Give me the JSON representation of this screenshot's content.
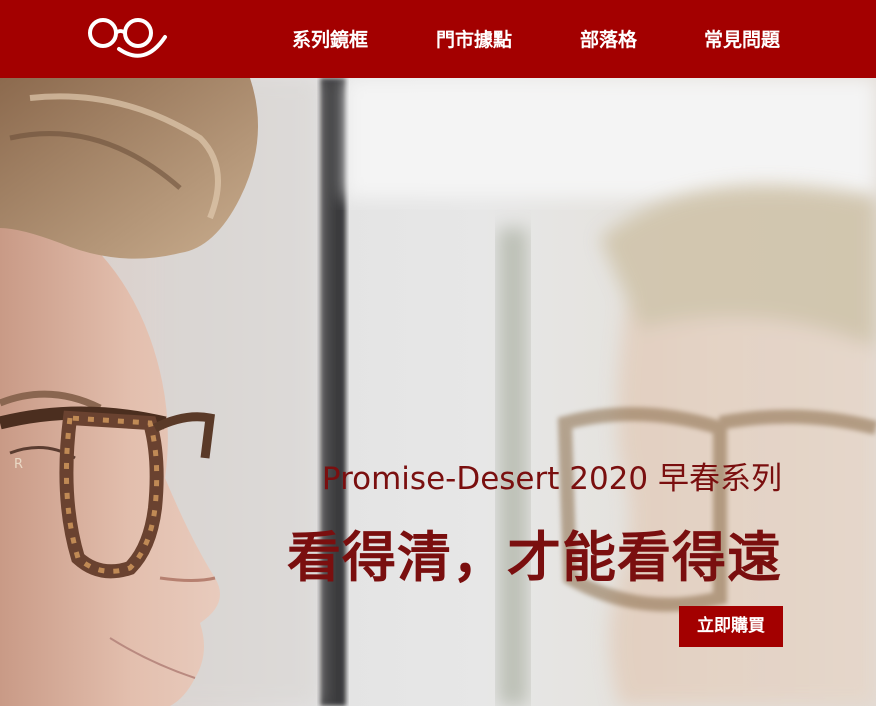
{
  "brand": {
    "logo_icon": "glasses-smile-logo-icon",
    "color": "#a30000"
  },
  "nav": {
    "items": [
      {
        "label": "系列鏡框"
      },
      {
        "label": "門市據點"
      },
      {
        "label": "部落格"
      },
      {
        "label": "常見問題"
      }
    ]
  },
  "hero": {
    "image": "man-with-tortoiseshell-glasses-reflection",
    "subtitle": "Promise-Desert 2020 早春系列",
    "title": "看得清，才能看得遠",
    "cta_label": "立即購買",
    "text_color": "#7a0f0f"
  }
}
